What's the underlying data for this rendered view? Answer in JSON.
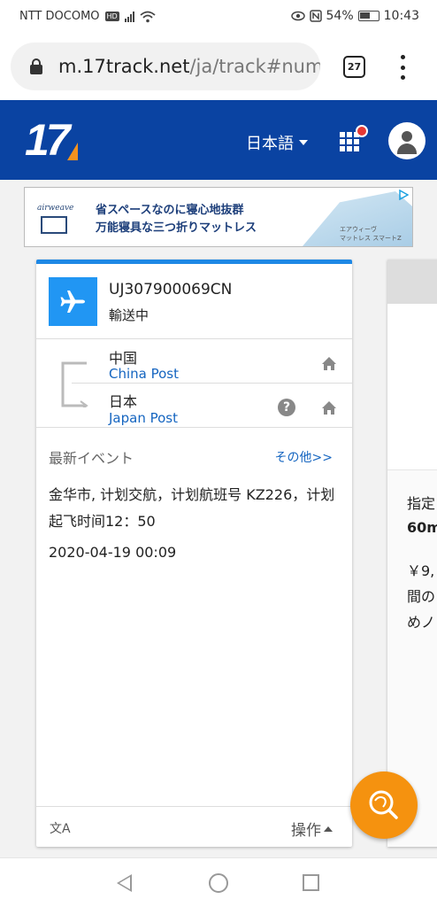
{
  "status_bar": {
    "carrier": "NTT DOCOMO",
    "hd_badge": "HD",
    "battery": "54%",
    "time": "10:43"
  },
  "browser": {
    "url_host": "m.17track.net",
    "url_path": "/ja/track#nums",
    "tab_count": "27"
  },
  "header": {
    "logo": "17",
    "language": "日本語",
    "brand_color": "#0a43a2",
    "accent_color": "#f5921e"
  },
  "ad": {
    "brand": "airweave",
    "line1": "省スペースなのに寝心地抜群",
    "line2": "万能寝具な三つ折りマットレス",
    "caption1": "エアウィーヴ",
    "caption2": "マットレス スマートZ"
  },
  "shipment": {
    "tracking_number": "UJ307900069CN",
    "status": "輸送中",
    "origin_country": "中国",
    "origin_carrier": "China Post",
    "destination_country": "日本",
    "destination_carrier": "Japan Post",
    "latest_event_label": "最新イベント",
    "more_link": "その他>>",
    "latest_event_text": "金华市, 计划交航，计划航班号 KZ226，计划起飞时间12：50",
    "latest_event_time": "2020-04-19 00:09",
    "translate_icon": "文A",
    "operations_label": "操作"
  },
  "side_card": {
    "line1": "指定",
    "line2": "60m",
    "line3": "￥9,",
    "line4": "間の",
    "line5": "めノ"
  },
  "icons": {
    "plane": "plane-icon",
    "home": "home-icon",
    "help": "help-icon",
    "fab": "track-search-icon"
  }
}
